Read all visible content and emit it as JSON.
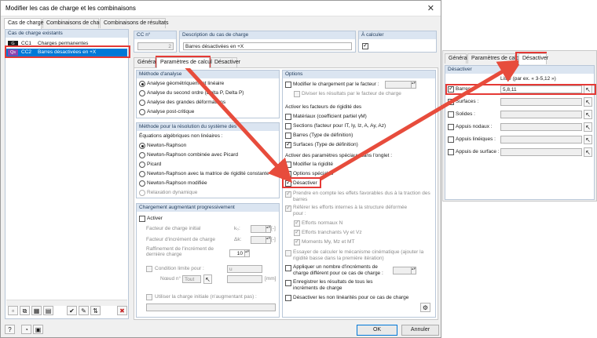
{
  "window": {
    "title": "Modifier les cas de charge et les combinaisons",
    "close": "✕"
  },
  "top_tabs": [
    "Cas de charge",
    "Combinaisons de charge",
    "Combinaisons de résultats"
  ],
  "lc_list": {
    "header": "Cas de charge existants",
    "items": [
      {
        "badge": "G",
        "id": "CC1",
        "name": "Charges permanentes",
        "selected": false,
        "color": "#1a1a1a"
      },
      {
        "badge": "Qs",
        "id": "CC2",
        "name": "Barres désactivées en +X",
        "selected": true,
        "color": "#8e44ad"
      }
    ]
  },
  "lc_header": {
    "no_label": "CC n°",
    "no_value": "2",
    "desc_label": "Description du cas de charge",
    "desc_value": "Barres désactivées en +X",
    "calc_label": "À calculer"
  },
  "sub_tabs": [
    "Général",
    "Paramètres de calcul",
    "Désactiver"
  ],
  "analysis": {
    "header": "Méthode d'analyse",
    "options": [
      "Analyse géométriquement linéaire",
      "Analyse du second ordre (Delta P, Delta P)",
      "Analyse des grandes déformations",
      "Analyse post-critique"
    ]
  },
  "solver": {
    "header": "Méthode pour la résolution du système des",
    "subheader": "Équations algébriques non linéaires :",
    "options": [
      "Newton-Raphson",
      "Newton-Raphson combinée avec Picard",
      "Picard",
      "Newton-Raphson avec la matrice de rigidité constante",
      "Newton-Raphson modifiée",
      "Relaxation dynamique"
    ]
  },
  "incremental": {
    "header": "Chargement augmentant progressivement",
    "activate": "Activer",
    "initial_factor": "Facteur de charge initial",
    "initial_sym": "k₀:",
    "increment_factor": "Facteur d'incrément de charge",
    "increment_sym": "Δk:",
    "refine": "Raffinement de l'incrément de dernière charge",
    "refine_value": "10",
    "limit": "Condition limite pour :",
    "limit_select": "u",
    "node": "Nœud n° :",
    "node_select": "Tout",
    "unit_bracket": "[-]",
    "unit_mm": "[mm]",
    "use_initial": "Utiliser la charge initiale (n'augmentant pas) :"
  },
  "options": {
    "header": "Options",
    "modify_load": "Modifier le chargement par le facteur :",
    "divide_results": "Diviser les résultats par le facteur de charge",
    "stiffness_header": "Activer les facteurs de rigidité des",
    "stiffness": [
      "Matériaux (coefficient partiel γM)",
      "Sections (facteur pour IT, Iy, Iz, A, Ay, Az)",
      "Barres (Type de définition)",
      "Surfaces (Type de définition)"
    ],
    "special_header": "Activer des paramètres spéciaux dans l'onglet :",
    "special": [
      "Modifier la rigidité",
      "Options spéciales",
      "Désactiver"
    ],
    "favorable": "Prendre en compte les effets favorables dus à la traction des barres",
    "refer": "Référer les efforts internes à la structure déformée pour :",
    "refer_items": [
      "Efforts normaux N",
      "Efforts tranchants Vy et Vz",
      "Moments My, Mz et MT"
    ],
    "kinematic": "Essayer de calculer le mécanisme cinématique (ajouter la rigidité basse dans la première itération)",
    "apply_inc": "Appliquer un nombre d'incréments de charge différent pour ce cas de charge :",
    "save": "Enregistrer les résultats de tous les incréments de charge",
    "deactivate_nl": "Désactiver les non linéarités pour ce cas de charge"
  },
  "footer": {
    "ok": "OK",
    "cancel": "Annuler"
  },
  "deactivate_dialog": {
    "tabs": [
      "Général",
      "Paramètres de calcul",
      "Désactiver"
    ],
    "header": "Désactiver",
    "list_hint": "Liste (par ex. « 3-5,12 »)",
    "rows": [
      {
        "label": "Barres :",
        "value": "5,8,11",
        "checked": true
      },
      {
        "label": "Surfaces :",
        "value": "",
        "checked": false
      },
      {
        "label": "Solides :",
        "value": "",
        "checked": false
      },
      {
        "label": "Appuis nodaux :",
        "value": "",
        "checked": false
      },
      {
        "label": "Appuis linéiques :",
        "value": "",
        "checked": false
      },
      {
        "label": "Appuis de surface :",
        "value": "",
        "checked": false
      }
    ]
  },
  "colors": {
    "accent": "#0078d7",
    "highlight": "#e53935",
    "arrow": "#e74c3c",
    "group_header": "#dbe5f1"
  },
  "icons": [
    "close-icon",
    "new-icon",
    "copy-icon",
    "rename-icon",
    "delete-icon",
    "help-icon",
    "select-icon"
  ]
}
